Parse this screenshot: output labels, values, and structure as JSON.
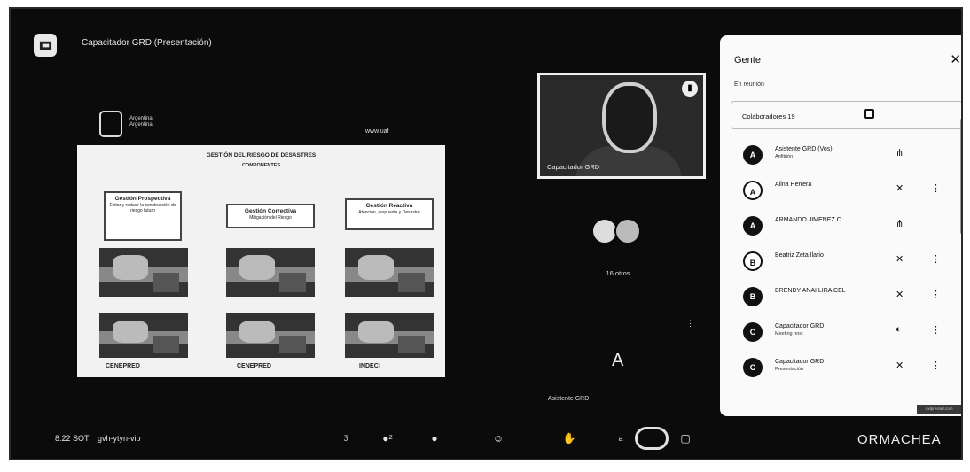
{
  "window": {
    "title": "Capacitador GRD (Presentación)"
  },
  "slide": {
    "org_name_line1": "Argentina",
    "org_name_line2": "Argentina",
    "website": "www.uaf",
    "heading": "GESTIÓN DEL RIESGO DE DESASTRES",
    "subheading": "COMPONENTES",
    "boxes": [
      {
        "title": "Gestión Prospectiva",
        "subtitle": "Evitar y reducir la construcción de riesgo futuro"
      },
      {
        "title": "Gestión Correctiva",
        "subtitle": "Mitigación del Riesgo"
      },
      {
        "title": "Gestión Reactiva",
        "subtitle": "Atención, respuesta y Desastre"
      }
    ],
    "orgs": [
      "CENEPRED",
      "INDECI"
    ]
  },
  "video": {
    "name": "Capacitador GRD"
  },
  "others": {
    "label": "16 otros"
  },
  "tile_a": {
    "letter": "A",
    "label": "Asistente GRD"
  },
  "people_panel": {
    "title": "Gente",
    "close_icon": "close-icon",
    "section": "En reunión",
    "collaborators_label": "Colaboradores  19",
    "participants": [
      {
        "name": "Asistente GRD (Vos)",
        "sub": "Anfitrión",
        "initial": "A",
        "mic": "audio-active-icon"
      },
      {
        "name": "Alina Herrera",
        "sub": "",
        "initial": "A",
        "mic": "mic-off-icon"
      },
      {
        "name": "ARMANDO JIMENEZ C...",
        "sub": "",
        "initial": "A",
        "mic": "audio-active-icon"
      },
      {
        "name": "Beatriz Zeta Ilario",
        "sub": "",
        "initial": "B",
        "mic": "mic-off-icon"
      },
      {
        "name": "BRENDY ANAI LIRA CEL",
        "sub": "",
        "initial": "B",
        "mic": "mic-off-icon"
      },
      {
        "name": "Capacitador GRD",
        "sub": "Meeting host",
        "initial": "C",
        "mic": "mic-on-icon"
      },
      {
        "name": "Capacitador GRD",
        "sub": "Presentación",
        "initial": "C",
        "mic": "mic-off-icon"
      }
    ]
  },
  "bottom": {
    "time": "8:22 SOT",
    "code": "gvh-ytyn-vip",
    "brand": "ORMACHEA",
    "tag": "Avlpresnet.com"
  }
}
